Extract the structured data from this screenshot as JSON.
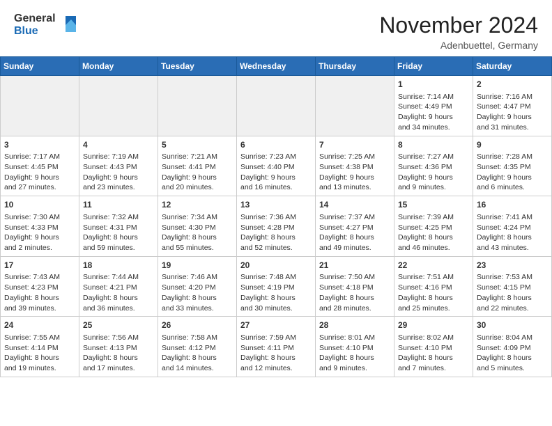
{
  "header": {
    "logo_line1": "General",
    "logo_line2": "Blue",
    "month": "November 2024",
    "location": "Adenbuettel, Germany"
  },
  "weekdays": [
    "Sunday",
    "Monday",
    "Tuesday",
    "Wednesday",
    "Thursday",
    "Friday",
    "Saturday"
  ],
  "weeks": [
    [
      {
        "day": "",
        "info": "",
        "empty": true
      },
      {
        "day": "",
        "info": "",
        "empty": true
      },
      {
        "day": "",
        "info": "",
        "empty": true
      },
      {
        "day": "",
        "info": "",
        "empty": true
      },
      {
        "day": "",
        "info": "",
        "empty": true
      },
      {
        "day": "1",
        "info": "Sunrise: 7:14 AM\nSunset: 4:49 PM\nDaylight: 9 hours\nand 34 minutes.",
        "empty": false
      },
      {
        "day": "2",
        "info": "Sunrise: 7:16 AM\nSunset: 4:47 PM\nDaylight: 9 hours\nand 31 minutes.",
        "empty": false
      }
    ],
    [
      {
        "day": "3",
        "info": "Sunrise: 7:17 AM\nSunset: 4:45 PM\nDaylight: 9 hours\nand 27 minutes.",
        "empty": false
      },
      {
        "day": "4",
        "info": "Sunrise: 7:19 AM\nSunset: 4:43 PM\nDaylight: 9 hours\nand 23 minutes.",
        "empty": false
      },
      {
        "day": "5",
        "info": "Sunrise: 7:21 AM\nSunset: 4:41 PM\nDaylight: 9 hours\nand 20 minutes.",
        "empty": false
      },
      {
        "day": "6",
        "info": "Sunrise: 7:23 AM\nSunset: 4:40 PM\nDaylight: 9 hours\nand 16 minutes.",
        "empty": false
      },
      {
        "day": "7",
        "info": "Sunrise: 7:25 AM\nSunset: 4:38 PM\nDaylight: 9 hours\nand 13 minutes.",
        "empty": false
      },
      {
        "day": "8",
        "info": "Sunrise: 7:27 AM\nSunset: 4:36 PM\nDaylight: 9 hours\nand 9 minutes.",
        "empty": false
      },
      {
        "day": "9",
        "info": "Sunrise: 7:28 AM\nSunset: 4:35 PM\nDaylight: 9 hours\nand 6 minutes.",
        "empty": false
      }
    ],
    [
      {
        "day": "10",
        "info": "Sunrise: 7:30 AM\nSunset: 4:33 PM\nDaylight: 9 hours\nand 2 minutes.",
        "empty": false
      },
      {
        "day": "11",
        "info": "Sunrise: 7:32 AM\nSunset: 4:31 PM\nDaylight: 8 hours\nand 59 minutes.",
        "empty": false
      },
      {
        "day": "12",
        "info": "Sunrise: 7:34 AM\nSunset: 4:30 PM\nDaylight: 8 hours\nand 55 minutes.",
        "empty": false
      },
      {
        "day": "13",
        "info": "Sunrise: 7:36 AM\nSunset: 4:28 PM\nDaylight: 8 hours\nand 52 minutes.",
        "empty": false
      },
      {
        "day": "14",
        "info": "Sunrise: 7:37 AM\nSunset: 4:27 PM\nDaylight: 8 hours\nand 49 minutes.",
        "empty": false
      },
      {
        "day": "15",
        "info": "Sunrise: 7:39 AM\nSunset: 4:25 PM\nDaylight: 8 hours\nand 46 minutes.",
        "empty": false
      },
      {
        "day": "16",
        "info": "Sunrise: 7:41 AM\nSunset: 4:24 PM\nDaylight: 8 hours\nand 43 minutes.",
        "empty": false
      }
    ],
    [
      {
        "day": "17",
        "info": "Sunrise: 7:43 AM\nSunset: 4:23 PM\nDaylight: 8 hours\nand 39 minutes.",
        "empty": false
      },
      {
        "day": "18",
        "info": "Sunrise: 7:44 AM\nSunset: 4:21 PM\nDaylight: 8 hours\nand 36 minutes.",
        "empty": false
      },
      {
        "day": "19",
        "info": "Sunrise: 7:46 AM\nSunset: 4:20 PM\nDaylight: 8 hours\nand 33 minutes.",
        "empty": false
      },
      {
        "day": "20",
        "info": "Sunrise: 7:48 AM\nSunset: 4:19 PM\nDaylight: 8 hours\nand 30 minutes.",
        "empty": false
      },
      {
        "day": "21",
        "info": "Sunrise: 7:50 AM\nSunset: 4:18 PM\nDaylight: 8 hours\nand 28 minutes.",
        "empty": false
      },
      {
        "day": "22",
        "info": "Sunrise: 7:51 AM\nSunset: 4:16 PM\nDaylight: 8 hours\nand 25 minutes.",
        "empty": false
      },
      {
        "day": "23",
        "info": "Sunrise: 7:53 AM\nSunset: 4:15 PM\nDaylight: 8 hours\nand 22 minutes.",
        "empty": false
      }
    ],
    [
      {
        "day": "24",
        "info": "Sunrise: 7:55 AM\nSunset: 4:14 PM\nDaylight: 8 hours\nand 19 minutes.",
        "empty": false
      },
      {
        "day": "25",
        "info": "Sunrise: 7:56 AM\nSunset: 4:13 PM\nDaylight: 8 hours\nand 17 minutes.",
        "empty": false
      },
      {
        "day": "26",
        "info": "Sunrise: 7:58 AM\nSunset: 4:12 PM\nDaylight: 8 hours\nand 14 minutes.",
        "empty": false
      },
      {
        "day": "27",
        "info": "Sunrise: 7:59 AM\nSunset: 4:11 PM\nDaylight: 8 hours\nand 12 minutes.",
        "empty": false
      },
      {
        "day": "28",
        "info": "Sunrise: 8:01 AM\nSunset: 4:10 PM\nDaylight: 8 hours\nand 9 minutes.",
        "empty": false
      },
      {
        "day": "29",
        "info": "Sunrise: 8:02 AM\nSunset: 4:10 PM\nDaylight: 8 hours\nand 7 minutes.",
        "empty": false
      },
      {
        "day": "30",
        "info": "Sunrise: 8:04 AM\nSunset: 4:09 PM\nDaylight: 8 hours\nand 5 minutes.",
        "empty": false
      }
    ]
  ]
}
